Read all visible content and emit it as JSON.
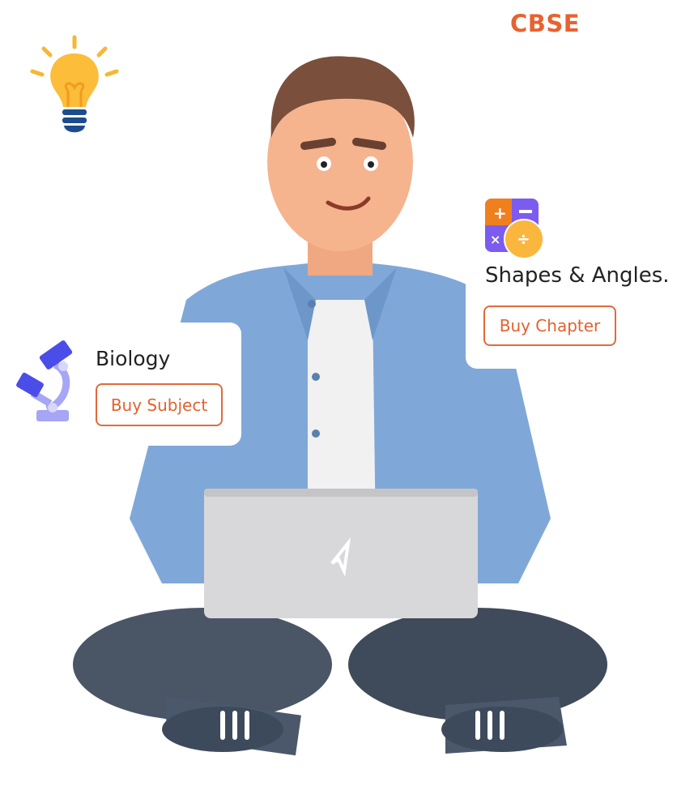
{
  "header": {
    "board_label": "CBSE"
  },
  "cards": [
    {
      "title": "Biology",
      "button_label": "Buy Subject",
      "icon": "microscope-icon"
    },
    {
      "title": "Shapes & Angles.",
      "button_label": "Buy Chapter",
      "icon": "calculator-icon"
    }
  ],
  "decor": {
    "lightbulb_icon": "lightbulb-icon"
  },
  "colors": {
    "accent": "#e8622f",
    "shirt": "#7fa8d8",
    "pants": "#4a5566"
  }
}
